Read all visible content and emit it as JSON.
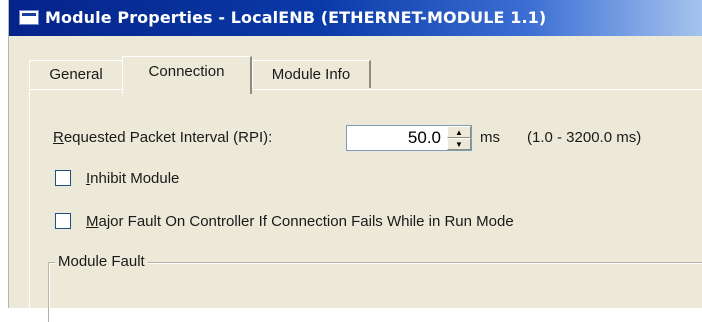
{
  "window": {
    "title": "Module Properties - LocalENB (ETHERNET-MODULE 1.1)",
    "icon": "window-icon"
  },
  "tabs": [
    {
      "label": "General",
      "active": false
    },
    {
      "label": "Connection",
      "active": true
    },
    {
      "label": "Module Info",
      "active": false
    }
  ],
  "connection": {
    "rpi_label_prefix": "R",
    "rpi_label_rest": "equested Packet Interval (RPI):",
    "rpi_value": "50.0",
    "rpi_unit": "ms",
    "rpi_range": "(1.0 - 3200.0 ms)",
    "inhibit": {
      "accel": "I",
      "rest": "nhibit Module",
      "checked": false
    },
    "major_fault": {
      "accel": "M",
      "rest": "ajor Fault On Controller If Connection Fails While in Run Mode",
      "checked": false
    },
    "module_fault_legend": "Module Fault"
  },
  "colors": {
    "titlebar_start": "#05238a",
    "titlebar_end": "#a6c4ee",
    "dialog_bg": "#ece9d8"
  }
}
